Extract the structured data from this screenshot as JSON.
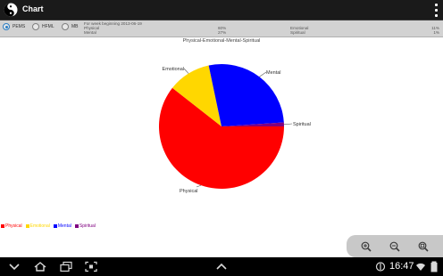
{
  "app": {
    "title": "Chart"
  },
  "options": {
    "radios": [
      {
        "label": "PEMS",
        "selected": true
      },
      {
        "label": "HFML",
        "selected": false
      },
      {
        "label": "MB",
        "selected": false
      }
    ],
    "week_label": "For week beginning 2013-06-19",
    "stats": [
      {
        "name": "Physical",
        "value": "60%",
        "name2": "Emotional",
        "value2": "11%"
      },
      {
        "name": "Mental",
        "value": "27%",
        "name2": "Spiritual",
        "value2": "1%"
      }
    ]
  },
  "chart_data": {
    "type": "pie",
    "title": "Physical-Emotional-Mental-Spiritual",
    "slices": [
      {
        "label": "Physical",
        "value": 60,
        "color": "#ff0000"
      },
      {
        "label": "Emotional",
        "value": 11,
        "color": "#ffd700"
      },
      {
        "label": "Mental",
        "value": 27,
        "color": "#0000ff"
      },
      {
        "label": "Spiritual",
        "value": 1,
        "color": "#800080"
      }
    ],
    "legend": "bottom-left"
  },
  "legend_items": [
    {
      "label": "Physical",
      "color": "#ff0000"
    },
    {
      "label": "Emotional",
      "color": "#ffd700"
    },
    {
      "label": "Mental",
      "color": "#0000ff"
    },
    {
      "label": "Spiritual",
      "color": "#800080"
    }
  ],
  "zoom": {
    "buttons": [
      "zoom-in-icon",
      "zoom-out-icon",
      "zoom-reset-icon"
    ]
  },
  "system_bar": {
    "time": "16:47"
  }
}
